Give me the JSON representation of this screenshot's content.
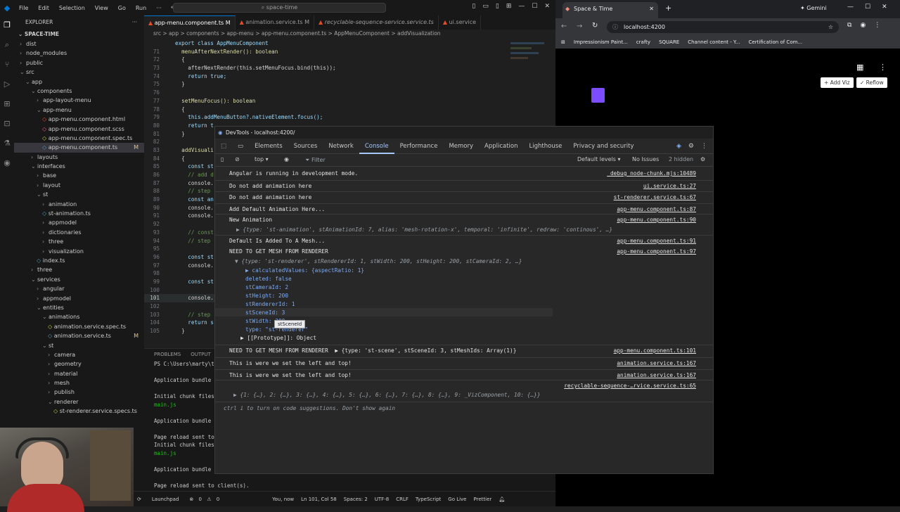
{
  "vscode": {
    "menu": [
      "File",
      "Edit",
      "Selection",
      "View",
      "Go",
      "Run"
    ],
    "search_placeholder": "space-time",
    "explorer_title": "EXPLORER",
    "workspace": "SPACE-TIME",
    "tree": [
      {
        "label": "dist",
        "indent": 1,
        "type": "folder-closed"
      },
      {
        "label": "node_modules",
        "indent": 1,
        "type": "folder-closed"
      },
      {
        "label": "public",
        "indent": 1,
        "type": "folder-closed"
      },
      {
        "label": "src",
        "indent": 1,
        "type": "folder-open"
      },
      {
        "label": "app",
        "indent": 2,
        "type": "folder-open"
      },
      {
        "label": "components",
        "indent": 3,
        "type": "folder-open"
      },
      {
        "label": "app-layout-menu",
        "indent": 4,
        "type": "folder-closed"
      },
      {
        "label": "app-menu",
        "indent": 4,
        "type": "folder-open"
      },
      {
        "label": "app-menu.component.html",
        "indent": 5,
        "type": "html"
      },
      {
        "label": "app-menu.component.scss",
        "indent": 5,
        "type": "scss"
      },
      {
        "label": "app-menu.component.spec.ts",
        "indent": 5,
        "type": "spec"
      },
      {
        "label": "app-menu.component.ts",
        "indent": 5,
        "type": "ts",
        "selected": true,
        "mod": "M"
      },
      {
        "label": "layouts",
        "indent": 3,
        "type": "folder-closed"
      },
      {
        "label": "interfaces",
        "indent": 3,
        "type": "folder-open"
      },
      {
        "label": "base",
        "indent": 4,
        "type": "folder-closed"
      },
      {
        "label": "layout",
        "indent": 4,
        "type": "folder-closed"
      },
      {
        "label": "st",
        "indent": 4,
        "type": "folder-open"
      },
      {
        "label": "animation",
        "indent": 5,
        "type": "folder-closed"
      },
      {
        "label": "st-animation.ts",
        "indent": 5,
        "type": "ts"
      },
      {
        "label": "appmodel",
        "indent": 5,
        "type": "folder-closed"
      },
      {
        "label": "dictionaries",
        "indent": 5,
        "type": "folder-closed"
      },
      {
        "label": "three",
        "indent": 5,
        "type": "folder-closed"
      },
      {
        "label": "visualization",
        "indent": 5,
        "type": "folder-closed"
      },
      {
        "label": "index.ts",
        "indent": 4,
        "type": "ts"
      },
      {
        "label": "three",
        "indent": 3,
        "type": "folder-closed"
      },
      {
        "label": "services",
        "indent": 3,
        "type": "folder-open"
      },
      {
        "label": "angular",
        "indent": 4,
        "type": "folder-closed"
      },
      {
        "label": "appmodel",
        "indent": 4,
        "type": "folder-closed"
      },
      {
        "label": "entities",
        "indent": 4,
        "type": "folder-open"
      },
      {
        "label": "animations",
        "indent": 5,
        "type": "folder-open"
      },
      {
        "label": "animation.service.spec.ts",
        "indent": 6,
        "type": "spec"
      },
      {
        "label": "animation.service.ts",
        "indent": 6,
        "type": "ts",
        "mod": "M"
      },
      {
        "label": "st",
        "indent": 5,
        "type": "folder-open"
      },
      {
        "label": "camera",
        "indent": 6,
        "type": "folder-closed"
      },
      {
        "label": "geometry",
        "indent": 6,
        "type": "folder-closed"
      },
      {
        "label": "material",
        "indent": 6,
        "type": "folder-closed"
      },
      {
        "label": "mesh",
        "indent": 6,
        "type": "folder-closed"
      },
      {
        "label": "publish",
        "indent": 6,
        "type": "folder-closed"
      },
      {
        "label": "renderer",
        "indent": 6,
        "type": "folder-open"
      },
      {
        "label": "st-renderer.service.specs.ts",
        "indent": 7,
        "type": "spec"
      }
    ],
    "tabs": [
      {
        "label": "app-menu.component.ts M",
        "active": true
      },
      {
        "label": "animation.service.ts M",
        "active": false
      },
      {
        "label": "recyclable-sequence-service.service.ts",
        "active": false
      },
      {
        "label": "ui.service",
        "active": false
      }
    ],
    "breadcrumb": "src > app > components > app-menu > app-menu.component.ts > AppMenuComponent > addVisualization",
    "code": [
      {
        "n": "",
        "t": "export class AppMenuComponent"
      },
      {
        "n": "71",
        "t": "  menuAfterNextRender(): boolean"
      },
      {
        "n": "72",
        "t": "  {"
      },
      {
        "n": "73",
        "t": "    afterNextRender(this.setMenuFocus.bind(this));"
      },
      {
        "n": "74",
        "t": "    return true;"
      },
      {
        "n": "75",
        "t": "  }"
      },
      {
        "n": "76",
        "t": ""
      },
      {
        "n": "77",
        "t": "  setMenuFocus(): boolean"
      },
      {
        "n": "78",
        "t": "  {"
      },
      {
        "n": "79",
        "t": "    this.addMenuButton?.nativeElement.focus();"
      },
      {
        "n": "80",
        "t": "    return t"
      },
      {
        "n": "81",
        "t": "  }"
      },
      {
        "n": "82",
        "t": ""
      },
      {
        "n": "83",
        "t": "  addVisuali"
      },
      {
        "n": "84",
        "t": "  {"
      },
      {
        "n": "85",
        "t": "    const st"
      },
      {
        "n": "86",
        "t": "    // add d"
      },
      {
        "n": "87",
        "t": "    console."
      },
      {
        "n": "88",
        "t": "    // step"
      },
      {
        "n": "89",
        "t": "    const an"
      },
      {
        "n": "90",
        "t": "    console."
      },
      {
        "n": "91",
        "t": "    console."
      },
      {
        "n": "92",
        "t": ""
      },
      {
        "n": "93",
        "t": "    // const"
      },
      {
        "n": "94",
        "t": "    // step"
      },
      {
        "n": "95",
        "t": ""
      },
      {
        "n": "96",
        "t": "    const st"
      },
      {
        "n": "97",
        "t": "    console."
      },
      {
        "n": "98",
        "t": ""
      },
      {
        "n": "99",
        "t": "    const st"
      },
      {
        "n": "100",
        "t": ""
      },
      {
        "n": "101",
        "t": "    console."
      },
      {
        "n": "102",
        "t": ""
      },
      {
        "n": "103",
        "t": "    // step"
      },
      {
        "n": "104",
        "t": "    return s"
      },
      {
        "n": "105",
        "t": "  }"
      }
    ],
    "panel_tabs": [
      "PROBLEMS",
      "OUTPUT"
    ],
    "terminal": [
      {
        "t": "PS C:\\Users\\marty\\to",
        "g": false
      },
      {
        "t": "",
        "g": false
      },
      {
        "t": "Application bundle g",
        "g": false
      },
      {
        "t": "",
        "g": false
      },
      {
        "t": "Initial chunk files",
        "g": false
      },
      {
        "t": "main.js",
        "g": true
      },
      {
        "t": "",
        "g": false
      },
      {
        "t": "Application bundle g",
        "g": false
      },
      {
        "t": "",
        "g": false
      },
      {
        "t": "Page reload sent to",
        "g": false
      },
      {
        "t": "Initial chunk files",
        "g": false
      },
      {
        "t": "main.js",
        "g": true
      },
      {
        "t": "",
        "g": false
      },
      {
        "t": "Application bundle g",
        "g": false
      },
      {
        "t": "",
        "g": false
      },
      {
        "t": "Page reload sent to client(s).",
        "g": false
      },
      {
        "t": "[]",
        "g": false
      }
    ],
    "status": {
      "launch": "Launchpad",
      "problems": "0",
      "warnings": "0",
      "author": "You, now",
      "cursor": "Ln 101, Col 58",
      "spaces": "Spaces: 2",
      "encoding": "UTF-8",
      "eol": "CRLF",
      "lang": "TypeScript",
      "golive": "Go Live",
      "prettier": "Prettier"
    }
  },
  "browser": {
    "tab_title": "Space & Time",
    "new_tab_plus": "+",
    "gemini": "Gemini",
    "url": "localhost:4200",
    "bookmarks": [
      "Impressionism Paint...",
      "crafty",
      "SQUARE",
      "Channel content - Y...",
      "Certification of Com..."
    ],
    "add_viz": "Add Viz",
    "reflow": "Reflow",
    "cube_color": "#7c4dff"
  },
  "devtools": {
    "title": "DevTools - localhost:4200/",
    "tabs": [
      "Elements",
      "Sources",
      "Network",
      "Console",
      "Performance",
      "Memory",
      "Application",
      "Lighthouse",
      "Privacy and security"
    ],
    "active_tab": "Console",
    "context": "top",
    "filter_placeholder": "Filter",
    "levels": "Default levels",
    "issues": "No Issues",
    "hidden": "2 hidden",
    "accent": "#a8c7fa",
    "tooltip": "stSceneId",
    "prompt_hint": "ctrl i to turn on code suggestions. Don't show again",
    "logs": [
      {
        "msg": "Angular is running in development mode.",
        "src": "_debug_node-chunk.mjs:10489"
      },
      {
        "msg": "Do not add animation here",
        "src": "ui.service.ts:27"
      },
      {
        "msg": "Do not add animation here",
        "src": "st-renderer.service.ts:67"
      },
      {
        "msg": "Add Default Animation Here...",
        "src": "app-menu.component.ts:87"
      },
      {
        "msg": "New Animation",
        "src": "app-menu.component.ts:90"
      },
      {
        "msg": "▶ {type: 'st-animation', stAnimationId: 7, alias: 'mesh-rotation-x', temporal: 'infinite', redraw: 'continous', …}",
        "src": ""
      },
      {
        "msg": "Default Is Added To A Mesh...",
        "src": "app-menu.component.ts:91"
      },
      {
        "msg": "NEED TO GET MESH FROM RENDERER",
        "src": "app-menu.component.ts:97"
      },
      {
        "msg": "▼ {type: 'st-renderer', stRendererId: 1, stWidth: 200, stHeight: 200, stCameraId: 2, …}",
        "src": ""
      },
      {
        "msg": "▶ calculatedValues: {aspectRatio: 1}",
        "src": ""
      },
      {
        "msg": "deleted: false",
        "src": ""
      },
      {
        "msg": "stCameraId: 2",
        "src": ""
      },
      {
        "msg": "stHeight: 200",
        "src": ""
      },
      {
        "msg": "stRendererId: 1",
        "src": ""
      },
      {
        "msg": "stSceneId: 3",
        "src": ""
      },
      {
        "msg": "stWidth: 200",
        "src": ""
      },
      {
        "msg": "type: \"st-renderer\"",
        "src": ""
      },
      {
        "msg": "▶ [[Prototype]]: Object",
        "src": ""
      },
      {
        "msg": "NEED TO GET MESH FROM RENDERER  ▶ {type: 'st-scene', stSceneId: 3, stMeshIds: Array(1)}",
        "src": "app-menu.component.ts:101"
      },
      {
        "msg": "This is were we set the left and top!",
        "src": "animation.service.ts:167"
      },
      {
        "msg": "This is were we set the left and top!",
        "src": "animation.service.ts:167"
      },
      {
        "msg": "",
        "src": "recyclable-sequence-…rvice.service.ts:65"
      },
      {
        "msg": "▶ {1: {…}, 2: {…}, 3: {…}, 4: {…}, 5: {…}, 6: {…}, 7: {…}, 8: {…}, 9: _VizComponent, 10: {…}}",
        "src": ""
      }
    ]
  }
}
